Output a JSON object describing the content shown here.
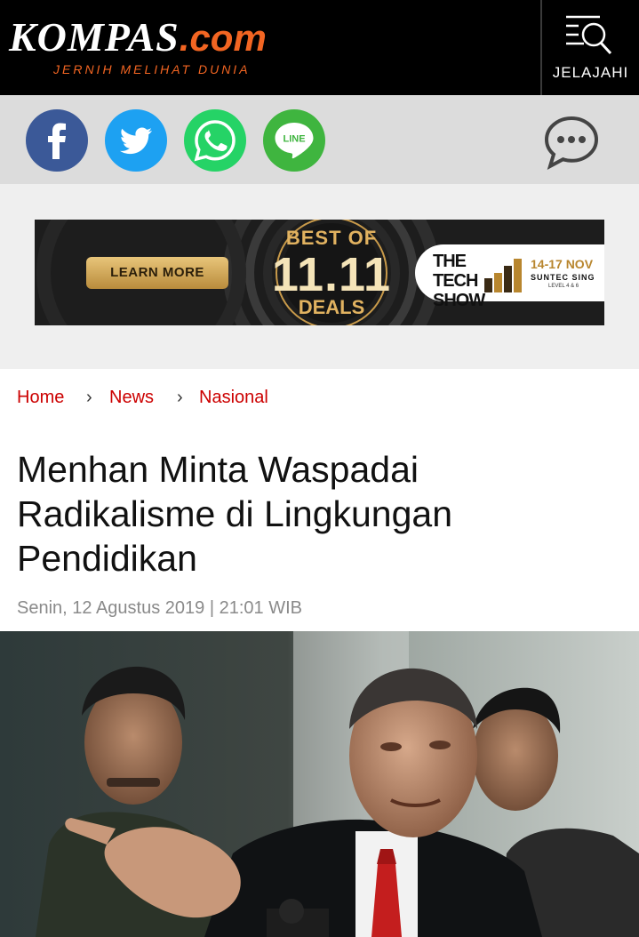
{
  "header": {
    "logo_text": "KOMPAS",
    "logo_suffix": ".com",
    "tagline": "JERNIH MELIHAT DUNIA",
    "explore_label": "JELAJAHI"
  },
  "share": {
    "buttons": [
      "facebook",
      "twitter",
      "whatsapp",
      "line"
    ],
    "line_label": "LINE"
  },
  "ad": {
    "learn_more": "LEARN MORE",
    "best_of": "BEST OF",
    "deals_number": "11.11",
    "deals_label": "DEALS",
    "show_title": "THE TECH SHOW",
    "show_dates": "14-17 NOV",
    "show_venue": "SUNTEC SING",
    "show_level": "LEVEL 4 & 6"
  },
  "breadcrumb": {
    "items": [
      "Home",
      "News",
      "Nasional"
    ],
    "separator": "›"
  },
  "article": {
    "title": "Menhan Minta Waspadai Radikalisme di Lingkungan Pendidikan",
    "date": "Senin, 12 Agustus 2019 | 21:01 WIB"
  },
  "colors": {
    "brand_orange": "#f26522",
    "breadcrumb_red": "#cc0000",
    "header_black": "#000000"
  },
  "icons": [
    "menu-search-icon",
    "facebook-icon",
    "twitter-icon",
    "whatsapp-icon",
    "line-icon",
    "comment-icon"
  ]
}
